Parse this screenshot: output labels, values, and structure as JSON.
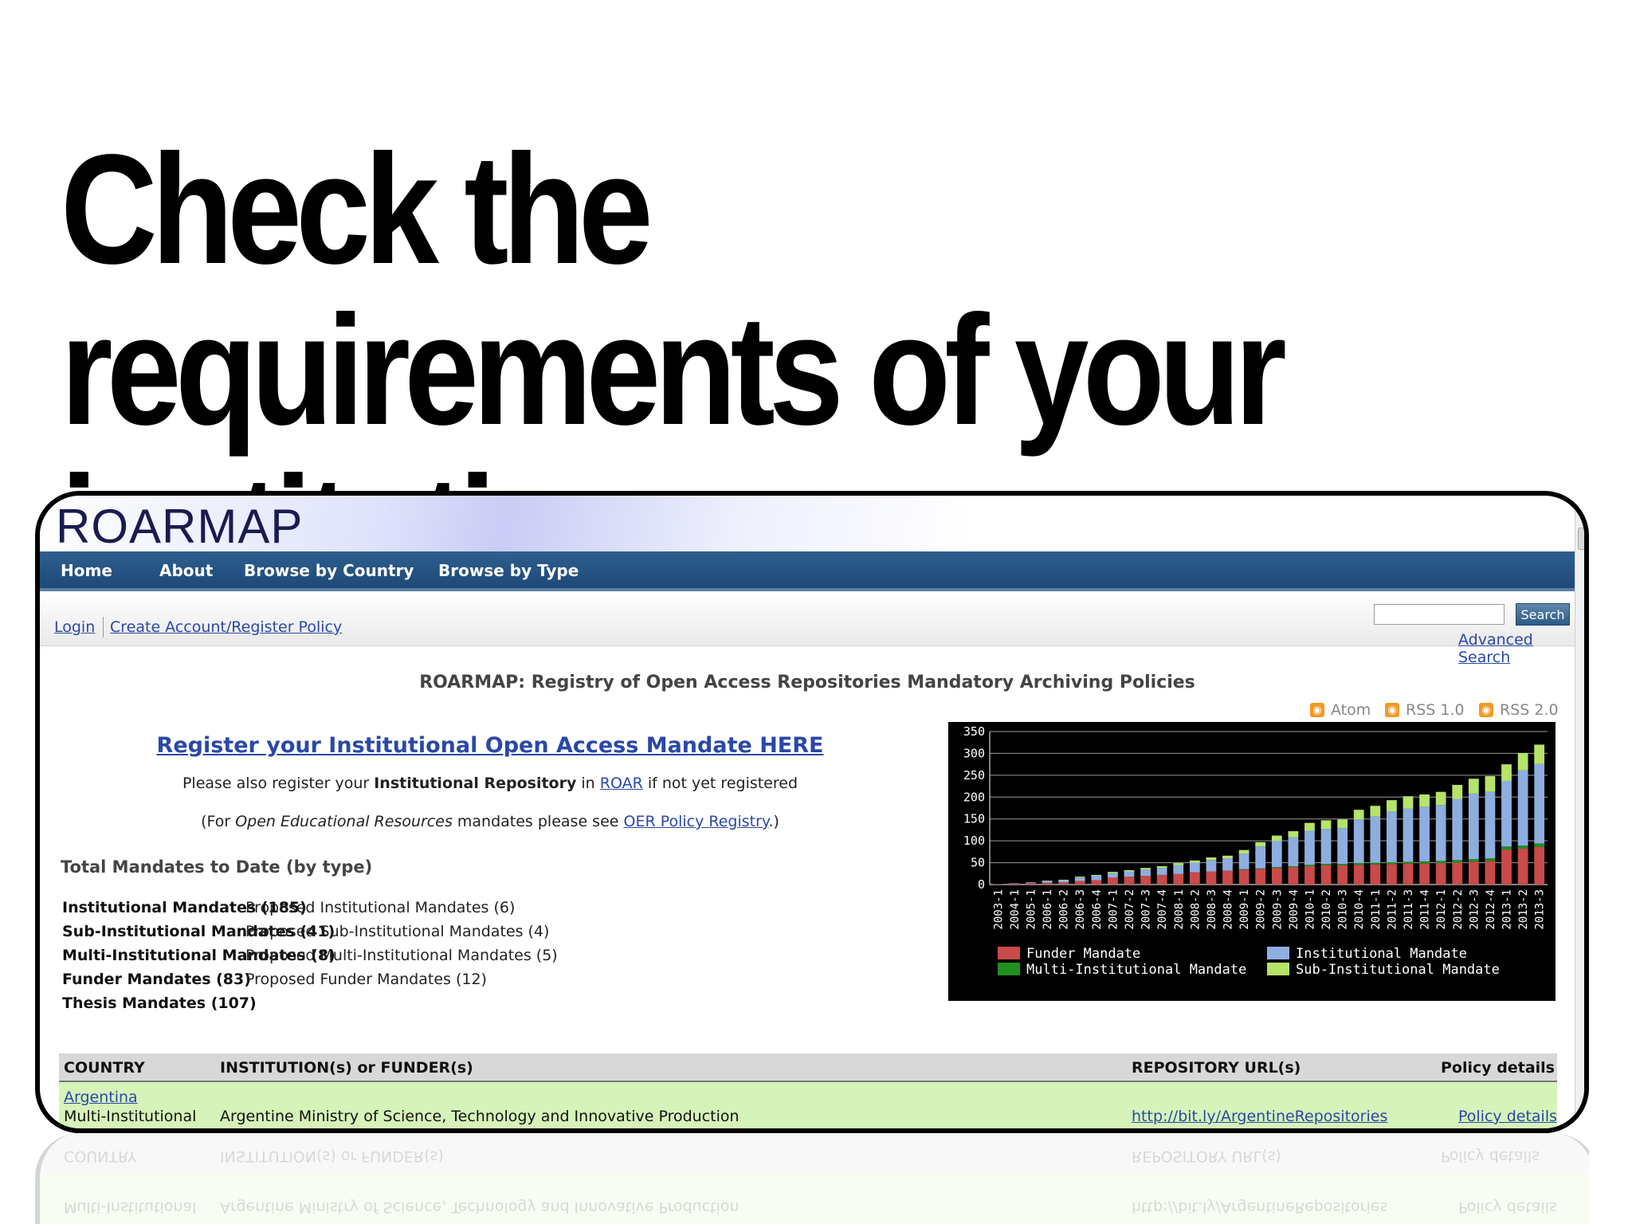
{
  "slide": {
    "title": "Check the requirements of your institution"
  },
  "site": {
    "logo": "ROARMAP",
    "nav": {
      "items": [
        "Home",
        "About",
        "Browse by Country",
        "Browse by Type"
      ]
    },
    "toolbar": {
      "login": "Login",
      "create": "Create Account/Register Policy",
      "search_button": "Search",
      "search_placeholder": "",
      "advanced": "Advanced Search"
    },
    "heading": "ROARMAP: Registry of Open Access Repositories Mandatory Archiving Policies",
    "feeds": [
      "Atom",
      "RSS 1.0",
      "RSS 2.0"
    ],
    "register_link": "Register your Institutional Open Access Mandate HERE",
    "line1": {
      "pre": "Please also register your ",
      "bold": "Institutional Repository",
      "mid": " in ",
      "link": "ROAR",
      "post": " if not yet registered"
    },
    "line2": {
      "pre": "(For ",
      "ital": "Open Educational Resources",
      "mid": " mandates please see ",
      "link": "OER Policy Registry",
      "post": ".)"
    },
    "totals_heading": "Total Mandates to Date (by type)",
    "totals": [
      {
        "bold": "Institutional Mandates (185)",
        "plain": "Proposed Institutional Mandates (6)"
      },
      {
        "bold": "Sub-Institutional Mandates (41)",
        "plain": "Proposed Sub-Institutional Mandates (4)"
      },
      {
        "bold": "Multi-Institutional Mandates (8)",
        "plain": "Proposed Multi-Institutional Mandates (5)"
      },
      {
        "bold": "Funder Mandates (83)",
        "plain": "Proposed Funder Mandates (12)"
      },
      {
        "bold": "Thesis Mandates (107)",
        "plain": ""
      }
    ],
    "table": {
      "headers": [
        "COUNTRY",
        "INSTITUTION(s) or FUNDER(s)",
        "REPOSITORY URL(s)",
        "Policy details"
      ],
      "row": {
        "country": "Argentina",
        "type": "Multi-Institutional",
        "institution": "Argentine Ministry of Science, Technology and Innovative Production",
        "url": "http://bit.ly/ArgentineRepositories",
        "policy": "Policy details"
      }
    }
  },
  "chart_data": {
    "type": "bar",
    "stacked": true,
    "categories": [
      "2003-1",
      "2004-1",
      "2005-1",
      "2006-1",
      "2006-2",
      "2006-3",
      "2006-4",
      "2007-1",
      "2007-2",
      "2007-3",
      "2007-4",
      "2008-1",
      "2008-2",
      "2008-3",
      "2008-4",
      "2009-1",
      "2009-2",
      "2009-3",
      "2009-4",
      "2010-1",
      "2010-2",
      "2010-3",
      "2010-4",
      "2011-1",
      "2011-2",
      "2011-3",
      "2011-4",
      "2012-1",
      "2012-2",
      "2012-3",
      "2012-4",
      "2013-1",
      "2013-2",
      "2013-3"
    ],
    "series": [
      {
        "name": "Funder Mandate",
        "color": "#c94a4a",
        "values": [
          1,
          2,
          3,
          4,
          5,
          8,
          10,
          16,
          18,
          20,
          22,
          24,
          28,
          30,
          32,
          34,
          36,
          38,
          40,
          42,
          44,
          44,
          45,
          46,
          47,
          48,
          48,
          49,
          50,
          52,
          54,
          80,
          82,
          86
        ]
      },
      {
        "name": "Institutional Mandate",
        "color": "#8eaee0",
        "values": [
          0,
          1,
          2,
          4,
          5,
          8,
          10,
          10,
          12,
          14,
          16,
          20,
          22,
          26,
          28,
          36,
          50,
          60,
          66,
          78,
          80,
          82,
          100,
          106,
          116,
          122,
          125,
          128,
          140,
          150,
          152,
          150,
          172,
          182
        ]
      },
      {
        "name": "Multi-Institutional Mandate",
        "color": "#1f8f1f",
        "values": [
          0,
          0,
          0,
          0,
          0,
          0,
          0,
          0,
          0,
          0,
          0,
          0,
          0,
          0,
          0,
          1,
          1,
          2,
          2,
          3,
          3,
          3,
          4,
          4,
          4,
          4,
          5,
          5,
          6,
          6,
          6,
          7,
          7,
          8
        ]
      },
      {
        "name": "Sub-Institutional Mandate",
        "color": "#b6e36a",
        "values": [
          0,
          0,
          0,
          1,
          1,
          2,
          2,
          3,
          3,
          4,
          4,
          5,
          5,
          6,
          6,
          8,
          10,
          12,
          14,
          18,
          20,
          20,
          22,
          24,
          26,
          28,
          28,
          30,
          32,
          34,
          36,
          38,
          40,
          44
        ]
      }
    ],
    "y_ticks": [
      "0",
      "50",
      "100",
      "150",
      "200",
      "250",
      "300",
      "350"
    ],
    "ylim": [
      0,
      350
    ],
    "legend": [
      "Funder Mandate",
      "Institutional Mandate",
      "Multi-Institutional Mandate",
      "Sub-Institutional Mandate"
    ],
    "legend_position": "bottom",
    "grid": true
  }
}
